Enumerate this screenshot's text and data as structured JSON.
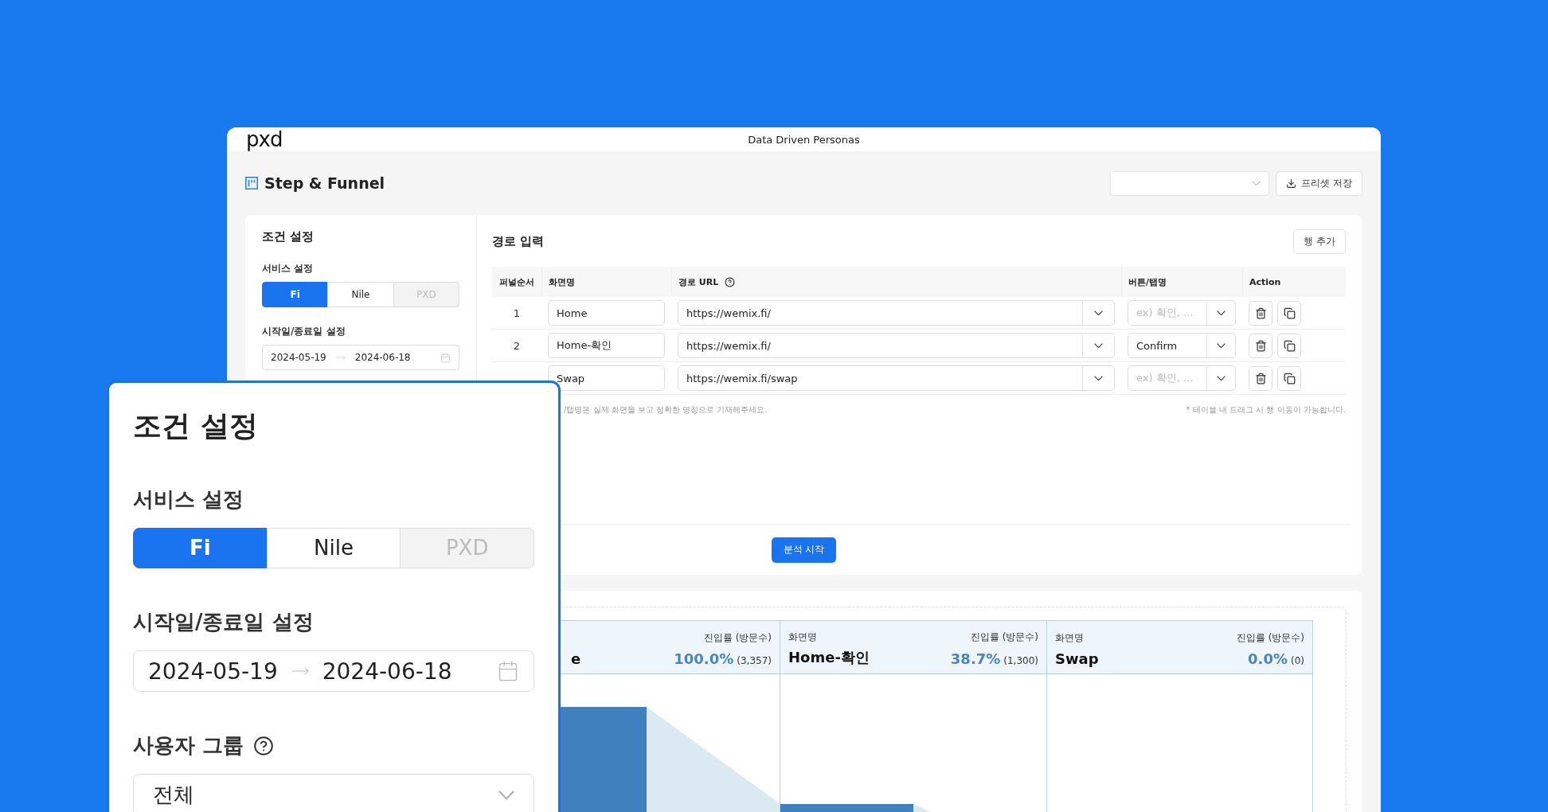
{
  "header": {
    "logo": "pxd",
    "title": "Data Driven Personas"
  },
  "page_title": "Step & Funnel",
  "toolbar": {
    "save_button": "프리셋 저장"
  },
  "conditions": {
    "title": "조건 설정",
    "service_label": "서비스 설정",
    "date_label": "시작일/종료일 설정",
    "start_date": "2024-05-19",
    "end_date": "2024-06-18",
    "services": [
      {
        "label": "Fi",
        "selected": true,
        "disabled": false
      },
      {
        "label": "Nile",
        "selected": false,
        "disabled": false
      },
      {
        "label": "PXD",
        "selected": false,
        "disabled": true
      }
    ]
  },
  "route": {
    "title": "경로 입력",
    "add_row_button": "행 추가",
    "columns": [
      "퍼널순서",
      "화면명",
      "경로 URL",
      "버튼/탭명",
      "Action"
    ],
    "rows": [
      {
        "order": "1",
        "screen": "Home",
        "url": "https://wemix.fi/",
        "button": {
          "placeholder": "ex) 확인, ..."
        }
      },
      {
        "order": "2",
        "screen": "Home-확인",
        "url": "https://wemix.fi/",
        "button": {
          "value": "Confirm"
        }
      },
      {
        "screen": "Swap",
        "url": "https://wemix.fi/swap",
        "button": {
          "placeholder": "ex) 확인, ..."
        }
      }
    ],
    "note_left": "/탭명은 실제 화면을 보고 정확한 명칭으로 기재해주세요.",
    "note_right": "* 테이블 내 드래그 시 행 이동이 가능합니다."
  },
  "start_button": "분석 시작",
  "funnel": [
    {
      "name": "e",
      "rate_label": "진입률 (방문수)",
      "rate": "100.0%",
      "count": "(3,357)"
    },
    {
      "label": "화면명",
      "name": "Home-확인",
      "rate_label": "진입률 (방문수)",
      "rate": "38.7%",
      "count": "(1,300)"
    },
    {
      "label": "화면명",
      "name": "Swap",
      "rate_label": "진입률 (방문수)",
      "rate": "0.0%",
      "count": "(0)"
    }
  ],
  "overlay": {
    "title": "조건 설정",
    "service_label": "서비스 설정",
    "date_label": "시작일/종료일 설정",
    "start_date": "2024-05-19",
    "end_date": "2024-06-18",
    "group_label": "사용자 그룹",
    "group_value": "전체",
    "services": [
      {
        "label": "Fi",
        "selected": true,
        "disabled": false
      },
      {
        "label": "Nile",
        "selected": false,
        "disabled": false
      },
      {
        "label": "PXD",
        "selected": false,
        "disabled": true
      }
    ]
  }
}
